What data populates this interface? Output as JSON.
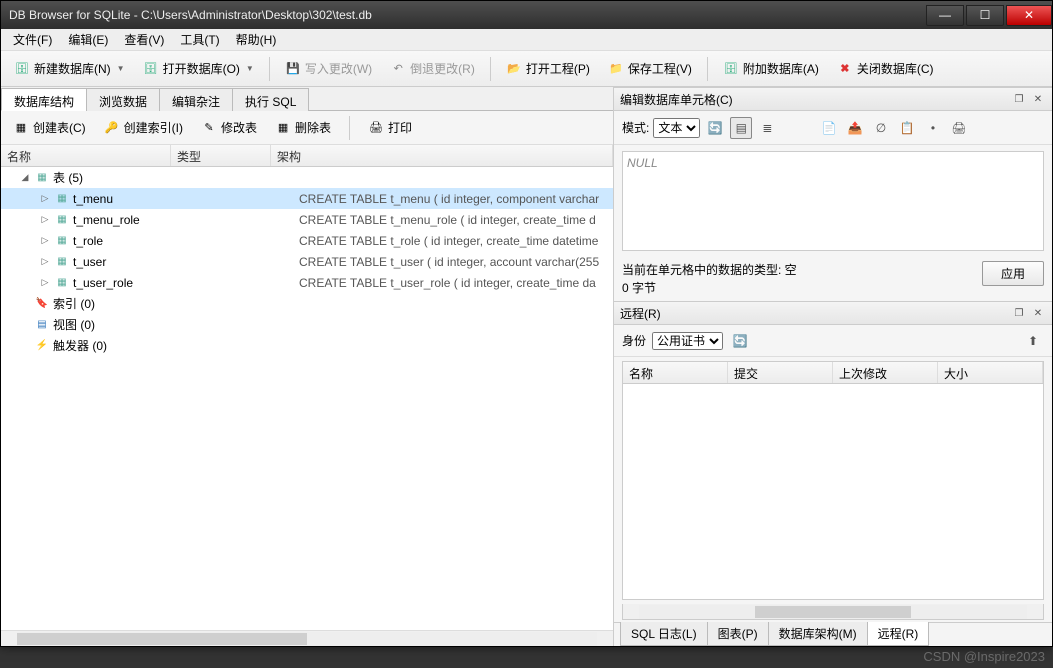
{
  "window": {
    "title": "DB Browser for SQLite - C:\\Users\\Administrator\\Desktop\\302\\test.db"
  },
  "menu": {
    "file": "文件(F)",
    "edit": "编辑(E)",
    "view": "查看(V)",
    "tools": "工具(T)",
    "help": "帮助(H)"
  },
  "toolbar": {
    "new_db": "新建数据库(N)",
    "open_db": "打开数据库(O)",
    "write_changes": "写入更改(W)",
    "revert": "倒退更改(R)",
    "open_proj": "打开工程(P)",
    "save_proj": "保存工程(V)",
    "attach": "附加数据库(A)",
    "close_db": "关闭数据库(C)"
  },
  "main_tabs": {
    "structure": "数据库结构",
    "browse": "浏览数据",
    "pragma": "编辑杂注",
    "sql": "执行 SQL"
  },
  "sub_toolbar": {
    "create_table": "创建表(C)",
    "create_index": "创建索引(I)",
    "modify": "修改表",
    "delete": "删除表",
    "print": "打印"
  },
  "tree_header": {
    "name": "名称",
    "type": "类型",
    "schema": "架构"
  },
  "tree": {
    "tables_label": "表 (5)",
    "tables": [
      {
        "name": "t_menu",
        "schema": "CREATE TABLE t_menu ( id integer, component varchar",
        "selected": true
      },
      {
        "name": "t_menu_role",
        "schema": "CREATE TABLE t_menu_role ( id integer, create_time d"
      },
      {
        "name": "t_role",
        "schema": "CREATE TABLE t_role ( id integer, create_time datetime"
      },
      {
        "name": "t_user",
        "schema": "CREATE TABLE t_user ( id integer, account varchar(255"
      },
      {
        "name": "t_user_role",
        "schema": "CREATE TABLE t_user_role ( id integer, create_time da"
      }
    ],
    "indexes": "索引 (0)",
    "views": "视图 (0)",
    "triggers": "触发器 (0)"
  },
  "cell_panel": {
    "title": "编辑数据库单元格(C)",
    "mode_label": "模式:",
    "mode_value": "文本",
    "value": "NULL",
    "type_info": "当前在单元格中的数据的类型: 空",
    "size_info": "0 字节",
    "apply": "应用"
  },
  "remote_panel": {
    "title": "远程(R)",
    "identity_label": "身份",
    "identity_value": "公用证书",
    "cols": {
      "name": "名称",
      "commit": "提交",
      "last_mod": "上次修改",
      "size": "大小"
    }
  },
  "bottom_tabs": {
    "log": "SQL 日志(L)",
    "plot": "图表(P)",
    "schema": "数据库架构(M)",
    "remote": "远程(R)"
  },
  "watermark": "CSDN @Inspire2023"
}
